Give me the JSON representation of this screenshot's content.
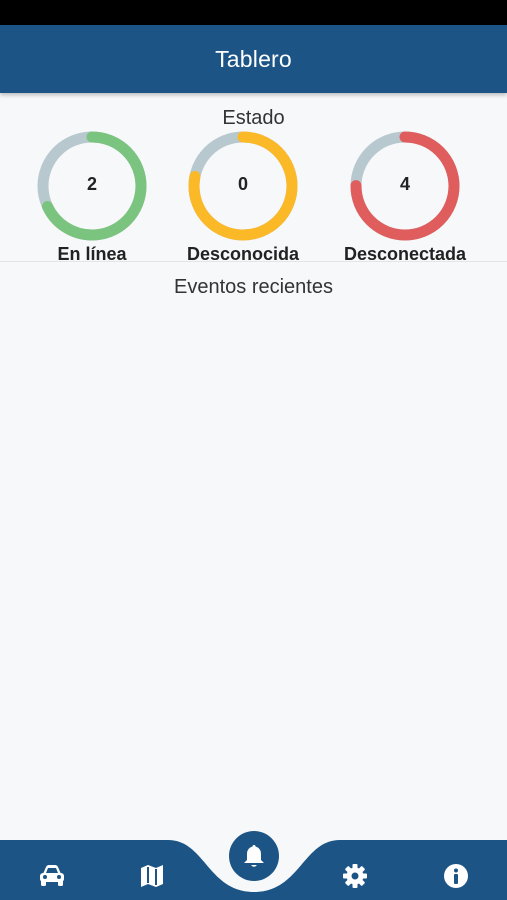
{
  "appbar": {
    "title": "Tablero"
  },
  "status_section": {
    "title": "Estado"
  },
  "gauges": [
    {
      "label": "En línea",
      "value": "2",
      "fraction": 0.68,
      "color": "#7bc47f"
    },
    {
      "label": "Desconocida",
      "value": "0",
      "fraction": 0.78,
      "color": "#fbb827"
    },
    {
      "label": "Desconectada",
      "value": "4",
      "fraction": 0.75,
      "color": "#e05d5d"
    }
  ],
  "events_section": {
    "title": "Eventos recientes"
  },
  "colors": {
    "primary": "#1c5585",
    "track": "#b8c8cf",
    "background": "#f7f8fa"
  },
  "bottom_nav": [
    {
      "icon": "car-icon"
    },
    {
      "icon": "map-icon"
    },
    {
      "icon": "bell-icon",
      "active": true
    },
    {
      "icon": "gear-icon"
    },
    {
      "icon": "info-icon"
    }
  ]
}
